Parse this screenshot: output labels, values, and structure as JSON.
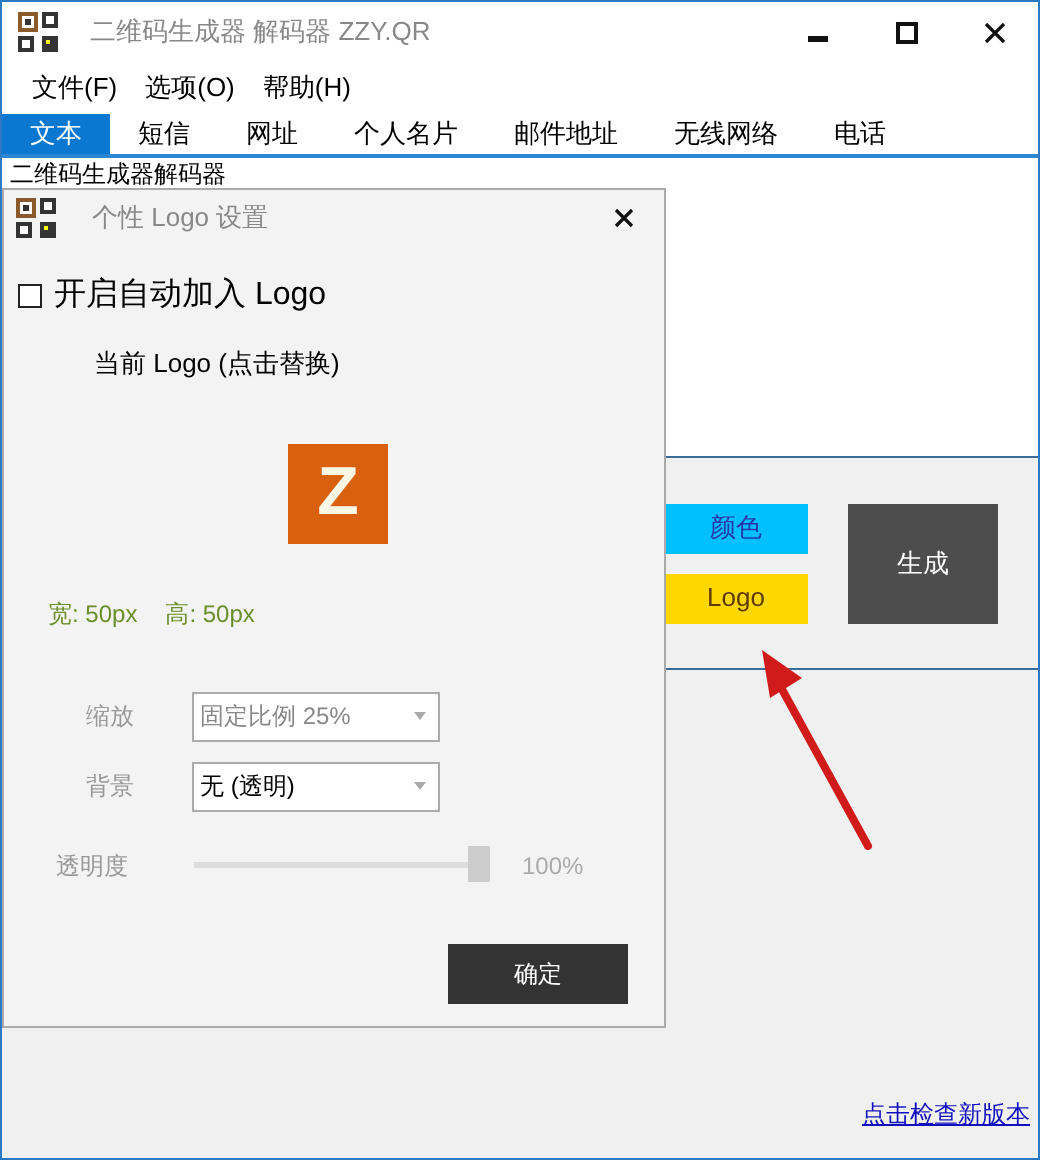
{
  "window": {
    "title": "二维码生成器 解码器 ZZY.QR"
  },
  "menu": [
    {
      "label": "文件(F)"
    },
    {
      "label": "选项(O)"
    },
    {
      "label": "帮助(H)"
    }
  ],
  "tabs": [
    {
      "label": "文本",
      "selected": true
    },
    {
      "label": "短信",
      "selected": false
    },
    {
      "label": "网址",
      "selected": false
    },
    {
      "label": "个人名片",
      "selected": false
    },
    {
      "label": "邮件地址",
      "selected": false
    },
    {
      "label": "无线网络",
      "selected": false
    },
    {
      "label": "电话",
      "selected": false
    }
  ],
  "text_area": {
    "value": "二维码生成器解码器"
  },
  "buttons": {
    "fill": "颜色",
    "logo": "Logo",
    "generate": "生成"
  },
  "update_link": "点击检查新版本",
  "dialog": {
    "title": "个性 Logo 设置",
    "auto_logo": {
      "label": "开启自动加入 Logo",
      "checked": false
    },
    "current_logo_label": "当前 Logo (点击替换)",
    "logo_letter": "Z",
    "width": "宽: 50px",
    "height": "高: 50px",
    "fields": [
      {
        "label": "缩放",
        "value": "固定比例 25%",
        "disabled": true
      },
      {
        "label": "背景",
        "value": "无 (透明)",
        "disabled": false
      }
    ],
    "opacity": {
      "label": "透明度",
      "level": 1,
      "reading": "100%",
      "disabled": true
    },
    "ok": "确定"
  }
}
